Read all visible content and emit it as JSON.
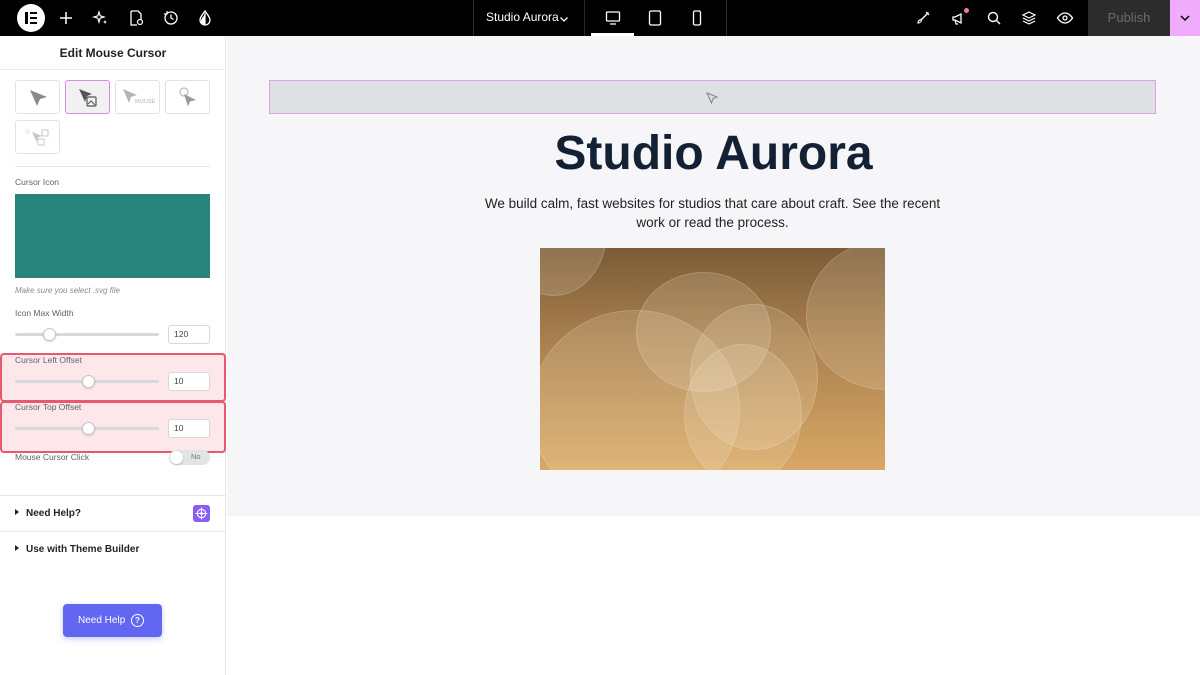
{
  "topbar": {
    "logo": "elementor-logo",
    "site_title": "Studio Aurora",
    "publish_label": "Publish",
    "icons": [
      "plus-icon",
      "sparkle-icon",
      "page-settings-icon",
      "history-icon",
      "theme-style-icon",
      "paint-brush-icon",
      "announcements-icon",
      "search-icon",
      "structure-icon",
      "preview-icon"
    ],
    "devices": [
      "desktop",
      "tablet",
      "mobile"
    ],
    "active_device": "desktop"
  },
  "panel": {
    "title": "Edit Mouse Cursor",
    "cursor_icon_label": "Cursor Icon",
    "svg_hint": "Make sure you select .svg file",
    "icon_max_width_label": "Icon Max Width",
    "icon_max_width_value": "120",
    "cursor_left_offset_label": "Cursor Left Offset",
    "cursor_left_offset_value": "10",
    "cursor_top_offset_label": "Cursor Top Offset",
    "cursor_top_offset_value": "10",
    "mouse_cursor_click_label": "Mouse Cursor Click",
    "mouse_cursor_click_state": "No",
    "cursor_type_option_text": "MOUSE",
    "selected_cursor_type": 2,
    "sections": [
      "Need Help?",
      "Use with Theme Builder"
    ],
    "help_button_label": "Need Help",
    "help_button_glyph": "?",
    "slider_levels": {
      "icon_max_width": 0.24,
      "cursor_left_offset": 0.51,
      "cursor_top_offset": 0.51
    }
  },
  "canvas": {
    "hero_title": "Studio Aurora",
    "hero_text": "We build calm, fast websites for studios that care about craft. See the recent work or read the process."
  },
  "colors": {
    "accent": "#e8596f",
    "selection": "#d98bdc",
    "publish_arrow": "#f0abfc",
    "help_button": "#6366f1",
    "cursor_preview": "#28837a",
    "title": "#142033"
  }
}
